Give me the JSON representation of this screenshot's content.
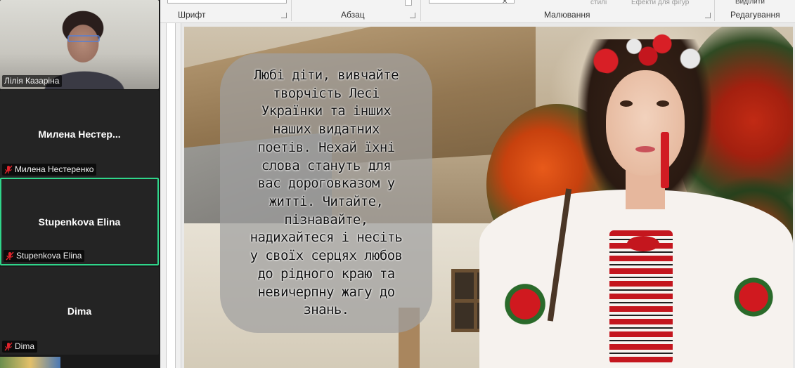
{
  "participants": [
    {
      "name": "Лілія Казаріна",
      "video": true,
      "muted": false
    },
    {
      "name": "Милена  Нестер...",
      "label": "Милена Нестеренко",
      "video": false,
      "muted": true
    },
    {
      "name": "Stupenkova Elina",
      "label": "Stupenkova Elina",
      "video": false,
      "muted": true,
      "active_speaker": true
    },
    {
      "name": "Dima",
      "label": "Dima",
      "video": false,
      "muted": true
    }
  ],
  "ribbon": {
    "groups": {
      "font": "Шрифт",
      "paragraph": "Абзац",
      "drawing": "Малювання",
      "editing": "Редагування"
    },
    "drawing_styles": "стилі",
    "shape_effects": "Ефекти для фігур",
    "select": "Виділити"
  },
  "slide": {
    "quote": "Любі діти, вивчайте\nтворчість Лесі\nУкраїнки та інших\nнаших видатних\nпоетів. Нехай їхні\nслова стануть для\nвас дороговказом у\nжитті. Читайте,\nпізнавайте,\nнадихайтеся і несіть\nу своїх серцях любов\nдо рідного краю та\nневичерпну жагу до\nзнань."
  },
  "colors": {
    "active_border": "#2fd58a",
    "muted_mic": "#e0232b",
    "panel_bg": "#242424"
  }
}
